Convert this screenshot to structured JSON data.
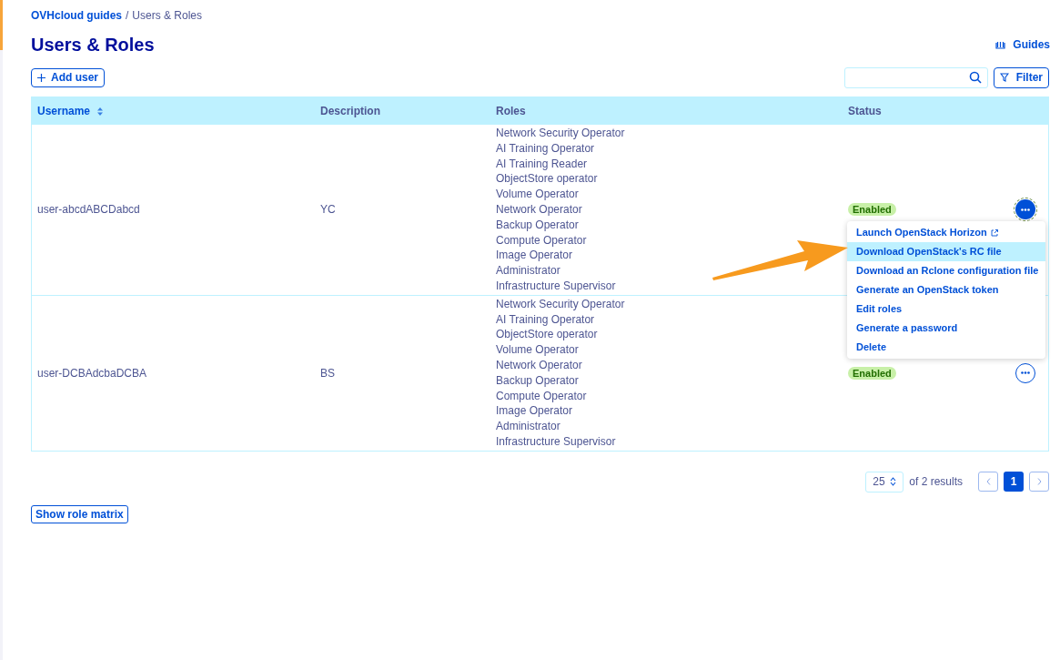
{
  "breadcrumb_separator": "/",
  "breadcrumb": [
    {
      "label": "OVHcloud guides",
      "kind": "link"
    },
    {
      "label": "Users & Roles",
      "kind": "current"
    }
  ],
  "title": "Users & Roles",
  "guides_link": "Guides",
  "add_button": "Add user",
  "filter_button": "Filter",
  "table": {
    "columns": [
      {
        "label": "Username",
        "sortable": true
      },
      {
        "label": "Description",
        "sortable": false
      },
      {
        "label": "Roles",
        "sortable": false
      },
      {
        "label": "Status",
        "sortable": false
      }
    ],
    "rows": [
      {
        "username": "user-abcdABCDabcd",
        "description": "YC",
        "roles": [
          "Network Security Operator",
          "AI Training Operator",
          "AI Training Reader",
          "ObjectStore operator",
          "Volume Operator",
          "Network Operator",
          "Backup Operator",
          "Compute Operator",
          "Image Operator",
          "Administrator",
          "Infrastructure Supervisor"
        ],
        "status": "Enabled",
        "menu_open": true
      },
      {
        "username": "user-DCBAdcbaDCBA",
        "description": "BS",
        "roles": [
          "Network Security Operator",
          "AI Training Operator",
          "ObjectStore operator",
          "Volume Operator",
          "Network Operator",
          "Backup Operator",
          "Compute Operator",
          "Image Operator",
          "Administrator",
          "Infrastructure Supervisor"
        ],
        "status": "Enabled",
        "menu_open": false
      }
    ]
  },
  "action_menu": [
    {
      "label": "Launch OpenStack Horizon",
      "external": true,
      "selected": false
    },
    {
      "label": "Download OpenStack's RC file",
      "external": false,
      "selected": true
    },
    {
      "label": "Download an Rclone configuration file",
      "external": false,
      "selected": false
    },
    {
      "label": "Generate an OpenStack token",
      "external": false,
      "selected": false
    },
    {
      "label": "Edit roles",
      "external": false,
      "selected": false
    },
    {
      "label": "Generate a password",
      "external": false,
      "selected": false
    },
    {
      "label": "Delete",
      "external": false,
      "selected": false
    }
  ],
  "pagination": {
    "page_size": "25",
    "summary": "of 2 results",
    "pages": [
      {
        "label": "1",
        "selected": true
      }
    ]
  },
  "role_matrix_button": "Show role matrix"
}
